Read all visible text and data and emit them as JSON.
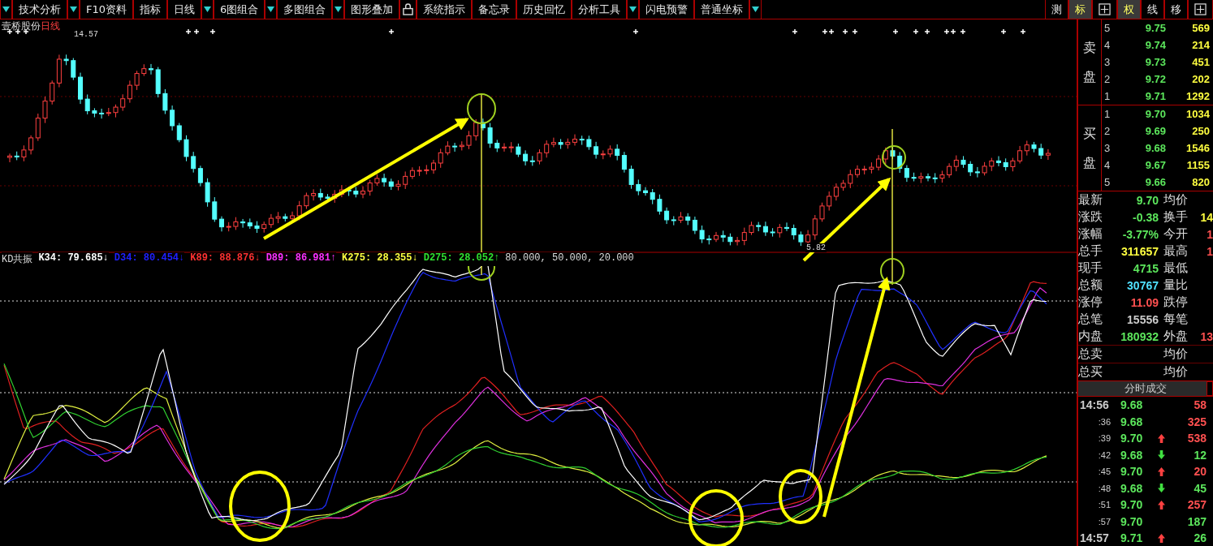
{
  "toolbar": {
    "items": [
      {
        "kind": "caret"
      },
      {
        "kind": "text",
        "label": "技术分析"
      },
      {
        "kind": "caret"
      },
      {
        "kind": "text",
        "label": "F10资料"
      },
      {
        "kind": "text",
        "label": "指标"
      },
      {
        "kind": "text",
        "label": "日线"
      },
      {
        "kind": "caret"
      },
      {
        "kind": "text",
        "label": "6图组合"
      },
      {
        "kind": "caret"
      },
      {
        "kind": "text",
        "label": "多图组合"
      },
      {
        "kind": "caret"
      },
      {
        "kind": "text",
        "label": "图形叠加"
      },
      {
        "kind": "lock"
      },
      {
        "kind": "text",
        "label": "系统指示"
      },
      {
        "kind": "text",
        "label": "备忘录"
      },
      {
        "kind": "text",
        "label": "历史回忆"
      },
      {
        "kind": "text",
        "label": "分析工具"
      },
      {
        "kind": "caret"
      },
      {
        "kind": "text",
        "label": "闪电预警"
      },
      {
        "kind": "text",
        "label": "普通坐标"
      },
      {
        "kind": "caret"
      }
    ],
    "right_buttons": [
      {
        "kind": "text",
        "label": "测",
        "selected": false
      },
      {
        "kind": "text",
        "label": "标",
        "selected": true
      },
      {
        "kind": "grid",
        "selected": false
      },
      {
        "kind": "text",
        "label": "权",
        "selected": true
      },
      {
        "kind": "text",
        "label": "线",
        "selected": false
      },
      {
        "kind": "text",
        "label": "移",
        "selected": false
      },
      {
        "kind": "grid",
        "selected": false
      }
    ]
  },
  "chart": {
    "stock_name": "壹桥股份",
    "period": "日线",
    "high_label": "14.57",
    "low_label": "5.82",
    "indicator": {
      "title": "KD共振",
      "series": [
        {
          "text": "K34: 79.685↓",
          "color": "#ffffff"
        },
        {
          "text": "D34: 80.454↓",
          "color": "#2020ff"
        },
        {
          "text": "K89: 88.876↓",
          "color": "#ff3030"
        },
        {
          "text": "D89: 86.981↑",
          "color": "#ff30ff"
        },
        {
          "text": "K275: 28.355↓",
          "color": "#ffff40"
        },
        {
          "text": "D275: 28.052↑",
          "color": "#30e030"
        }
      ],
      "levels": "80.000, 50.000, 20.000"
    }
  },
  "order_book": {
    "sell_label": "卖盘",
    "buy_label": "买盘",
    "sell": [
      {
        "rank": "5",
        "price": "9.75",
        "volume": "569"
      },
      {
        "rank": "4",
        "price": "9.74",
        "volume": "214"
      },
      {
        "rank": "3",
        "price": "9.73",
        "volume": "451"
      },
      {
        "rank": "2",
        "price": "9.72",
        "volume": "202"
      },
      {
        "rank": "1",
        "price": "9.71",
        "volume": "1292"
      }
    ],
    "buy": [
      {
        "rank": "1",
        "price": "9.70",
        "volume": "1034"
      },
      {
        "rank": "2",
        "price": "9.69",
        "volume": "250"
      },
      {
        "rank": "3",
        "price": "9.68",
        "volume": "1546"
      },
      {
        "rank": "4",
        "price": "9.67",
        "volume": "1155"
      },
      {
        "rank": "5",
        "price": "9.66",
        "volume": "820"
      }
    ]
  },
  "quote_stats": [
    {
      "label": "最新",
      "value": "9.70",
      "color": "#5ce65c",
      "label2": "均价"
    },
    {
      "label": "涨跌",
      "value": "-0.38",
      "color": "#5ce65c",
      "label2": "换手",
      "extra": {
        "text": "14",
        "color": "#ffff40"
      }
    },
    {
      "label": "涨幅",
      "value": "-3.77%",
      "color": "#5ce65c",
      "label2": "今开",
      "extra": {
        "text": "1",
        "color": "#ff5050"
      }
    },
    {
      "label": "总手",
      "value": "311657",
      "color": "#ffff40",
      "label2": "最高",
      "extra": {
        "text": "1",
        "color": "#ff5050"
      }
    },
    {
      "label": "现手",
      "value": "4715",
      "color": "#5ce65c",
      "label2": "最低"
    },
    {
      "label": "总额",
      "value": "30767",
      "color": "#50e0ff",
      "label2": "量比"
    },
    {
      "label": "涨停",
      "value": "11.09",
      "color": "#ff5050",
      "label2": "跌停"
    },
    {
      "label": "总笔",
      "value": "15556",
      "color": "#cccccc",
      "label2": "每笔"
    },
    {
      "label": "内盘",
      "value": "180932",
      "color": "#5ce65c",
      "label2": "外盘",
      "extra": {
        "text": "13",
        "color": "#ff5050"
      }
    }
  ],
  "totals": [
    {
      "label": "总卖",
      "label2": "均价"
    },
    {
      "label": "总买",
      "label2": "均价"
    }
  ],
  "ticks": {
    "title": "分时成交",
    "rows": [
      {
        "time": "14:56",
        "kind": "full",
        "price": "9.68",
        "up": false,
        "down": false,
        "volume": "58",
        "color": "#ff5050"
      },
      {
        "time": ":36",
        "kind": "short",
        "price": "9.68",
        "up": false,
        "down": false,
        "volume": "325",
        "color": "#ff5050"
      },
      {
        "time": ":39",
        "kind": "short",
        "price": "9.70",
        "up": true,
        "down": false,
        "volume": "538",
        "color": "#ff5050"
      },
      {
        "time": ":42",
        "kind": "short",
        "price": "9.68",
        "up": false,
        "down": true,
        "volume": "12",
        "color": "#5ce65c"
      },
      {
        "time": ":45",
        "kind": "short",
        "price": "9.70",
        "up": true,
        "down": false,
        "volume": "20",
        "color": "#ff5050"
      },
      {
        "time": ":48",
        "kind": "short",
        "price": "9.68",
        "up": false,
        "down": true,
        "volume": "45",
        "color": "#5ce65c"
      },
      {
        "time": ":51",
        "kind": "short",
        "price": "9.70",
        "up": true,
        "down": false,
        "volume": "257",
        "color": "#ff5050"
      },
      {
        "time": ":57",
        "kind": "short",
        "price": "9.70",
        "up": false,
        "down": false,
        "volume": "187",
        "color": "#5ce65c"
      },
      {
        "time": "14:57",
        "kind": "full",
        "price": "9.71",
        "up": true,
        "down": false,
        "volume": "26",
        "color": "#5ce65c"
      }
    ]
  }
}
